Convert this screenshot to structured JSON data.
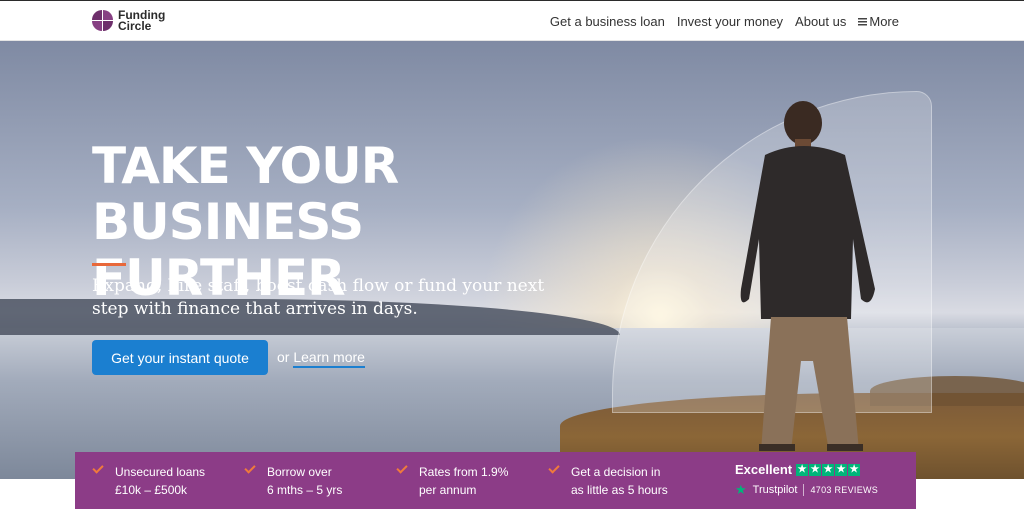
{
  "brand": {
    "name_line1": "Funding",
    "name_line2": "Circle"
  },
  "nav": {
    "items": [
      "Get a business loan",
      "Invest your money",
      "About us"
    ],
    "more_label": "More"
  },
  "hero": {
    "headline": "Take your business further",
    "subcopy": "Expand, hire staff, boost cash flow or fund your next step with finance that arrives in days.",
    "cta_label": "Get your instant quote",
    "or_text": "or",
    "learn_more": "Learn more"
  },
  "features": [
    {
      "line1": "Unsecured loans",
      "line2": "£10k – £500k"
    },
    {
      "line1": "Borrow over",
      "line2": "6 mths – 5 yrs"
    },
    {
      "line1": "Rates from 1.9%",
      "line2": "per annum"
    },
    {
      "line1": "Get a decision in",
      "line2": "as little as 5 hours"
    }
  ],
  "trustpilot": {
    "rating_label": "Excellent",
    "brand": "Trustpilot",
    "reviews": "4703 REVIEWS",
    "stars": 5,
    "star_color": "#00b67a"
  },
  "colors": {
    "brand_purple": "#8c3c87",
    "cta_blue": "#1b7fd0",
    "accent_orange": "#e8683a"
  }
}
